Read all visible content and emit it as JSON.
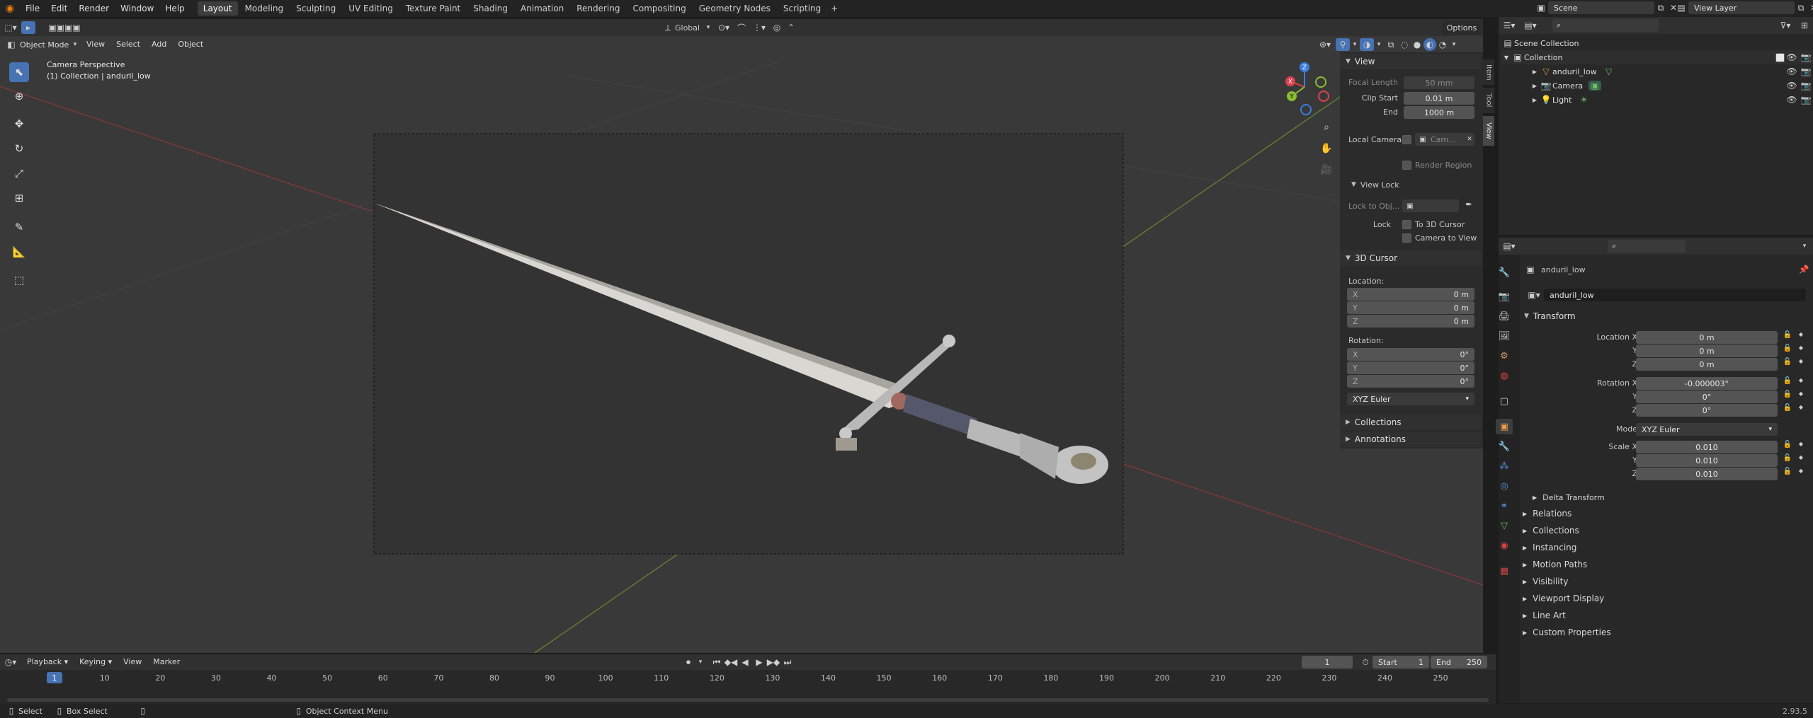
{
  "topbar": {
    "menus": [
      "File",
      "Edit",
      "Render",
      "Window",
      "Help"
    ],
    "workspaces": [
      "Layout",
      "Modeling",
      "Sculpting",
      "UV Editing",
      "Texture Paint",
      "Shading",
      "Animation",
      "Rendering",
      "Compositing",
      "Geometry Nodes",
      "Scripting"
    ],
    "active_workspace": "Layout",
    "scene_name": "Scene",
    "view_layer": "View Layer"
  },
  "viewport_header": {
    "mode": "Object Mode",
    "menus": [
      "View",
      "Select",
      "Add",
      "Object"
    ],
    "orientation": "Global",
    "options": "Options"
  },
  "viewport": {
    "overlay_title": "Camera Perspective",
    "overlay_subtitle": "(1) Collection | anduril_low",
    "gizmo": {
      "x": "X",
      "y": "Y",
      "z": "Z"
    }
  },
  "sidebar": {
    "tabs": [
      "Item",
      "Tool",
      "View"
    ],
    "view_panel": {
      "title": "View",
      "focal_length_label": "Focal Length",
      "focal_length": "50 mm",
      "clip_start_label": "Clip Start",
      "clip_start": "0.01 m",
      "end_label": "End",
      "end": "1000 m",
      "local_camera_label": "Local Camera",
      "local_camera_value": "Cam...",
      "render_region": "Render Region"
    },
    "view_lock": {
      "title": "View Lock",
      "lock_to_obj": "Lock to Obj...",
      "lock_label": "Lock",
      "to_3d_cursor": "To 3D Cursor",
      "camera_to_view": "Camera to View"
    },
    "cursor_panel": {
      "title": "3D Cursor",
      "location_label": "Location:",
      "location": [
        {
          "axis": "X",
          "value": "0 m"
        },
        {
          "axis": "Y",
          "value": "0 m"
        },
        {
          "axis": "Z",
          "value": "0 m"
        }
      ],
      "rotation_label": "Rotation:",
      "rotation": [
        {
          "axis": "X",
          "value": "0°"
        },
        {
          "axis": "Y",
          "value": "0°"
        },
        {
          "axis": "Z",
          "value": "0°"
        }
      ],
      "rotation_mode": "XYZ Euler"
    },
    "collections": "Collections",
    "annotations": "Annotations"
  },
  "outliner": {
    "root": "Scene Collection",
    "collection": "Collection",
    "items": [
      "anduril_low",
      "Camera",
      "Light"
    ]
  },
  "properties": {
    "object_name": "anduril_low",
    "data_name": "anduril_low",
    "transform_title": "Transform",
    "location_label": "Location X",
    "location": [
      "0 m",
      "0 m",
      "0 m"
    ],
    "rotation_label": "Rotation X",
    "rotation": [
      "-0.000003°",
      "0°",
      "0°"
    ],
    "mode_label": "Mode",
    "mode": "XYZ Euler",
    "scale_label": "Scale X",
    "scale": [
      "0.010",
      "0.010",
      "0.010"
    ],
    "axis_y": "Y",
    "axis_z": "Z",
    "delta_transform": "Delta Transform",
    "sections": [
      "Relations",
      "Collections",
      "Instancing",
      "Motion Paths",
      "Visibility",
      "Viewport Display",
      "Line Art",
      "Custom Properties"
    ]
  },
  "timeline": {
    "menus": [
      "Playback",
      "Keying",
      "View",
      "Marker"
    ],
    "current_frame": "1",
    "start_label": "Start",
    "start": "1",
    "end_label": "End",
    "end": "250",
    "ticks": [
      "1",
      "10",
      "20",
      "30",
      "40",
      "50",
      "60",
      "70",
      "80",
      "90",
      "100",
      "110",
      "120",
      "130",
      "140",
      "150",
      "160",
      "170",
      "180",
      "190",
      "200",
      "210",
      "220",
      "230",
      "240",
      "250"
    ]
  },
  "statusbar": {
    "select": "Select",
    "box_select": "Box Select",
    "context_menu": "Object Context Menu",
    "version": "2.93.5"
  },
  "colors": {
    "accent": "#4772b3",
    "x_axis": "#e0414f",
    "y_axis": "#8bbd32",
    "z_axis": "#3b7ee0"
  }
}
